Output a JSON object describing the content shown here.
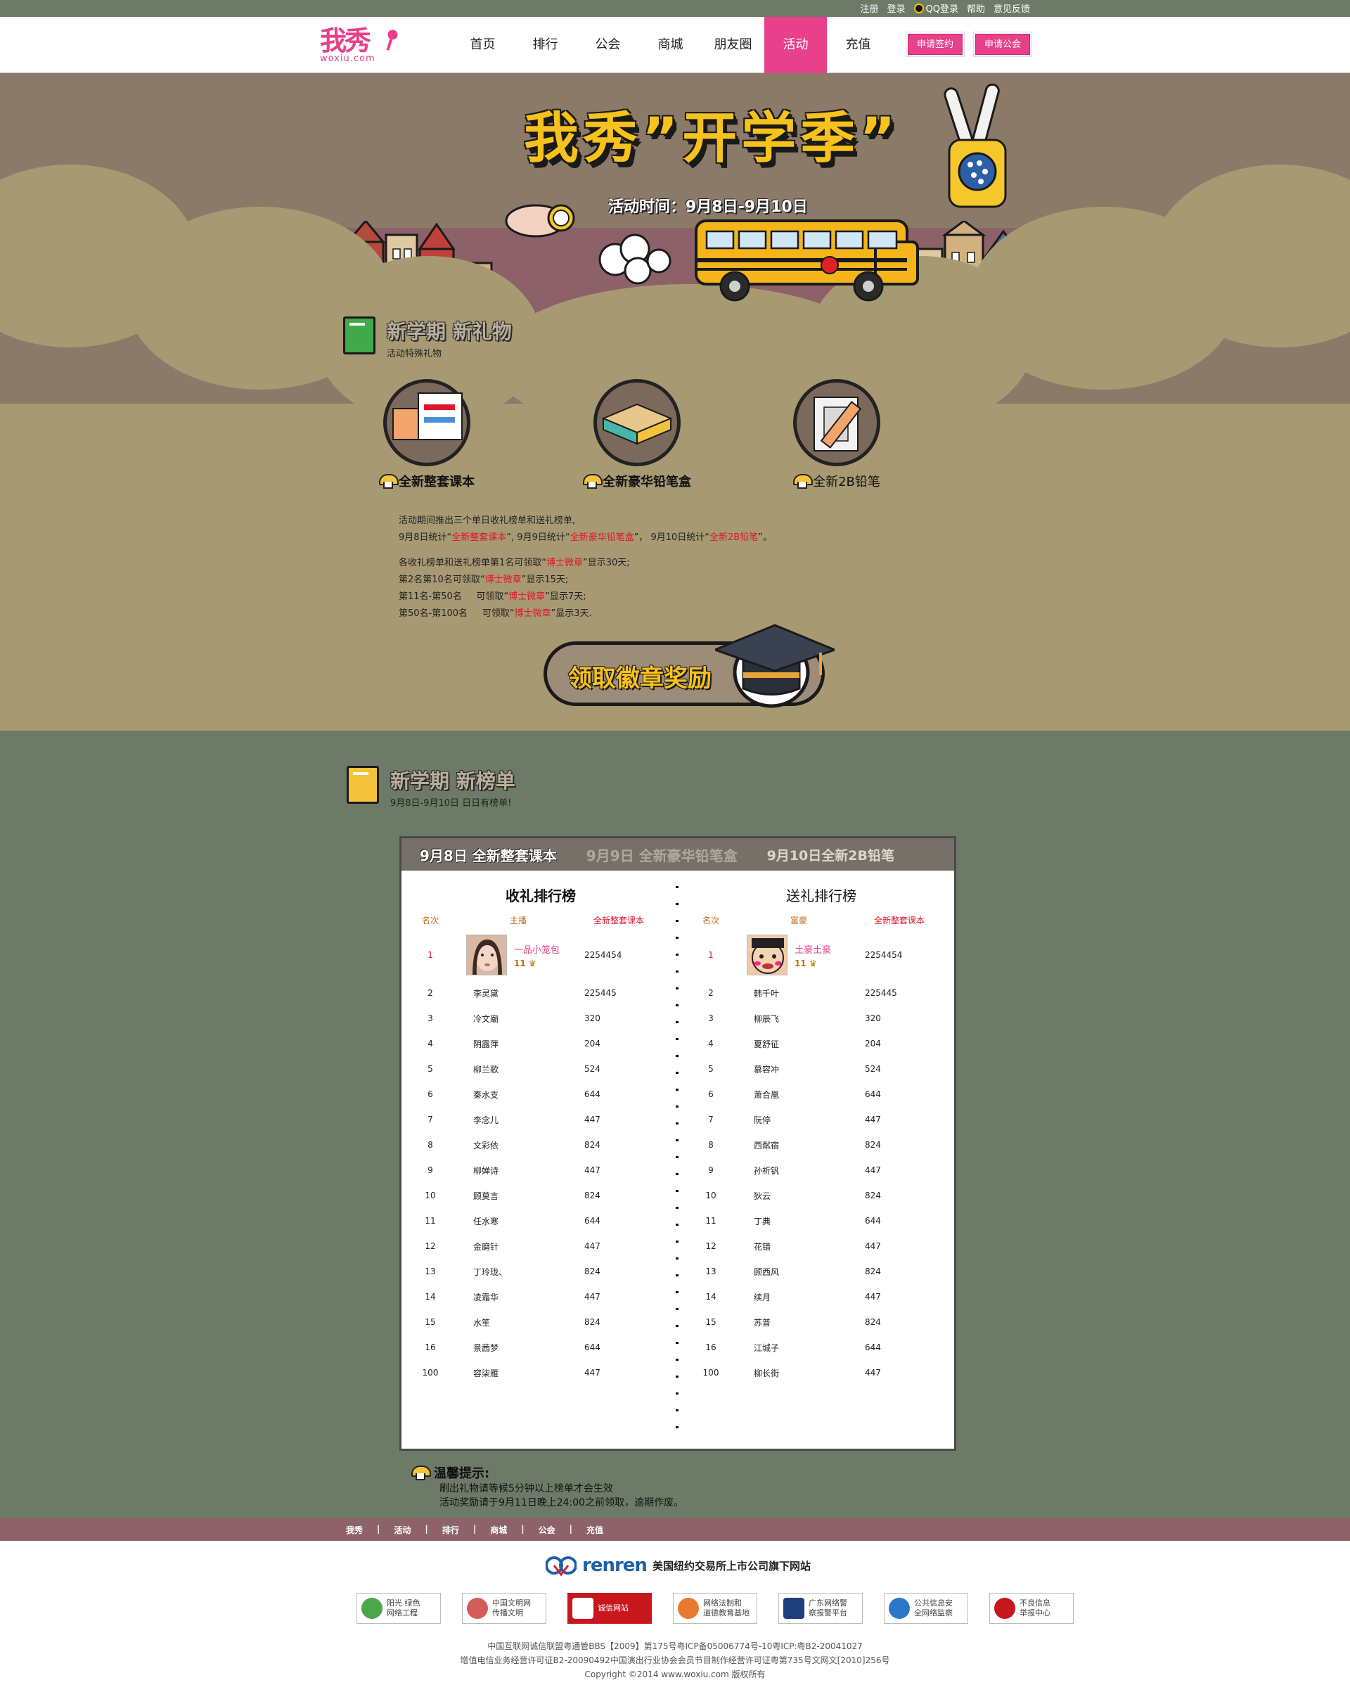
{
  "toplinks": {
    "register": "注册",
    "login": "登录",
    "qq_login": "QQ登录",
    "help": "帮助",
    "feedback": "意见反馈"
  },
  "logo": {
    "text": "我秀",
    "domain": "woxiu.com"
  },
  "nav": [
    {
      "label": "首页",
      "active": false
    },
    {
      "label": "排行",
      "active": false
    },
    {
      "label": "公会",
      "active": false
    },
    {
      "label": "商城",
      "active": false
    },
    {
      "label": "朋友圈",
      "active": false
    },
    {
      "label": "活动",
      "active": true
    },
    {
      "label": "充值",
      "active": false
    }
  ],
  "apply": {
    "sign": "申请签约",
    "guild": "申请公会"
  },
  "hero": {
    "title": "我秀”开学季”",
    "date": "活动时间：9月8日-9月10日"
  },
  "gifts_section": {
    "title": "新学期 新礼物",
    "subtitle": "活动特殊礼物"
  },
  "gifts": [
    {
      "label": "全新整套课本",
      "icon": "textbook-icon"
    },
    {
      "label": "全新豪华铅笔盒",
      "icon": "pencil-case-icon"
    },
    {
      "label": "全新2B铅笔",
      "icon": "pencil-icon"
    }
  ],
  "rules": {
    "l1": "活动期间推出三个单日收礼榜单和送礼榜单,",
    "l2a": "9月8日统计“",
    "l2b": "全新整套课本",
    "l2c": "”, 9月9日统计“",
    "l2d": "全新豪华铅笔盒",
    "l2e": "”， 9月10日统计“",
    "l2f": "全新2B铅笔",
    "l2g": "”。",
    "l3a": "各收礼榜单和送礼榜单第1名可领取“",
    "l3b": "博士微章",
    "l3c": "”显示30天;",
    "l4a": "第2名第10名可领取“",
    "l4b": "博士微章",
    "l4c": "”显示15天;",
    "l5a": "第11名-第50名     可领取“",
    "l5b": "博士微章",
    "l5c": "”显示7天;",
    "l6a": "第50名-第100名     可领取“",
    "l6b": "博士微章",
    "l6c": "”显示3天."
  },
  "claim_button": "领取徽章奖励",
  "rank_section": {
    "title": "新学期 新榜单",
    "subtitle": "9月8日-9月10日 日日有榜单!"
  },
  "tabs": [
    "9月8日 全新整套课本",
    "9月9日 全新豪华铅笔盒",
    "9月10日全新2B铅笔"
  ],
  "receive": {
    "title": "收礼排行榜",
    "headers": [
      "名次",
      "主播",
      "全新整套课本"
    ],
    "top": {
      "rank": "1",
      "name": "一品小笼包",
      "level": "11",
      "score": "2254454"
    },
    "rows": [
      [
        "2",
        "李灵黛",
        "225445"
      ],
      [
        "3",
        "冷文廟",
        "320"
      ],
      [
        "4",
        "阴露萍",
        "204"
      ],
      [
        "5",
        "柳兰歌",
        "524"
      ],
      [
        "6",
        "秦水支",
        "644"
      ],
      [
        "7",
        "李念儿",
        "447"
      ],
      [
        "8",
        "文彩依",
        "824"
      ],
      [
        "9",
        "柳婵诗",
        "447"
      ],
      [
        "10",
        "顾莫言",
        "824"
      ],
      [
        "11",
        "任水寒",
        "644"
      ],
      [
        "12",
        "金磨针",
        "447"
      ],
      [
        "13",
        "丁玲珑、",
        "824"
      ],
      [
        "14",
        "凌霜华",
        "447"
      ],
      [
        "15",
        "水笙",
        "824"
      ],
      [
        "16",
        "景茜梦",
        "644"
      ],
      [
        "100",
        "容柒雁",
        "447"
      ]
    ]
  },
  "send": {
    "title": "送礼排行榜",
    "headers": [
      "名次",
      "富豪",
      "全新整套课本"
    ],
    "top": {
      "rank": "1",
      "name": "土豪土豪",
      "level": "11",
      "score": "2254454"
    },
    "rows": [
      [
        "2",
        "韩千叶",
        "225445"
      ],
      [
        "3",
        "柳辰飞",
        "320"
      ],
      [
        "4",
        "夏舒征",
        "204"
      ],
      [
        "5",
        "慕容冲",
        "524"
      ],
      [
        "6",
        "萧合凰",
        "644"
      ],
      [
        "7",
        "阮停",
        "447"
      ],
      [
        "8",
        "西粼宿",
        "824"
      ],
      [
        "9",
        "孙祈钒",
        "447"
      ],
      [
        "10",
        "狄云",
        "824"
      ],
      [
        "11",
        "丁典",
        "644"
      ],
      [
        "12",
        "花错",
        "447"
      ],
      [
        "13",
        "顾西风",
        "824"
      ],
      [
        "14",
        "续月",
        "447"
      ],
      [
        "15",
        "苏普",
        "824"
      ],
      [
        "16",
        "江城子",
        "644"
      ],
      [
        "100",
        "柳长街",
        "447"
      ]
    ]
  },
  "tips": {
    "title": "温馨提示:",
    "l1": "刷出礼物请等候5分钟以上榜单才会生效",
    "l2": "活动奖励请于9月11日晚上24:00之前领取，逾期作废。"
  },
  "footer_links": [
    "我秀",
    "活动",
    "排行",
    "商城",
    "公会",
    "充值"
  ],
  "renren": {
    "logo": "renren",
    "text": "美国纽约交易所上市公司旗下网站"
  },
  "badges": [
    {
      "text": "阳光 绿色\n网络工程",
      "icon": "green-network-icon"
    },
    {
      "text": "中国文明网\n传播文明",
      "icon": "civilization-icon"
    },
    {
      "text": "诚信网站",
      "icon": "trust-icon"
    },
    {
      "text": "网络法制和\n道德教育基地",
      "icon": "sunshine-icon"
    },
    {
      "text": "广东网络警\n察报警平台",
      "icon": "police-icon"
    },
    {
      "text": "公共信息安\n全网络监察",
      "icon": "security-icon"
    },
    {
      "text": "不良信息\n举报中心",
      "icon": "report-icon"
    }
  ],
  "copyright": {
    "l1": "中国互联网诚信联盟粤通管BBS【2009】第175号粤ICP备05006774号-10粤ICP:粤B2-20041027",
    "l2": "增值电信业务经营许可证B2-20090492中国演出行业协会会员节目制作经营许可证粤第735号文网文[2010]256号",
    "l3": "Copyright ©2014 www.woxiu.com 版权所有"
  },
  "colors": {
    "brand": "#e8408a",
    "highlight": "#e1162c",
    "hero_bg": "#a79a72",
    "rank_bg": "#6e7a68",
    "footer_nav": "#8d6268"
  }
}
